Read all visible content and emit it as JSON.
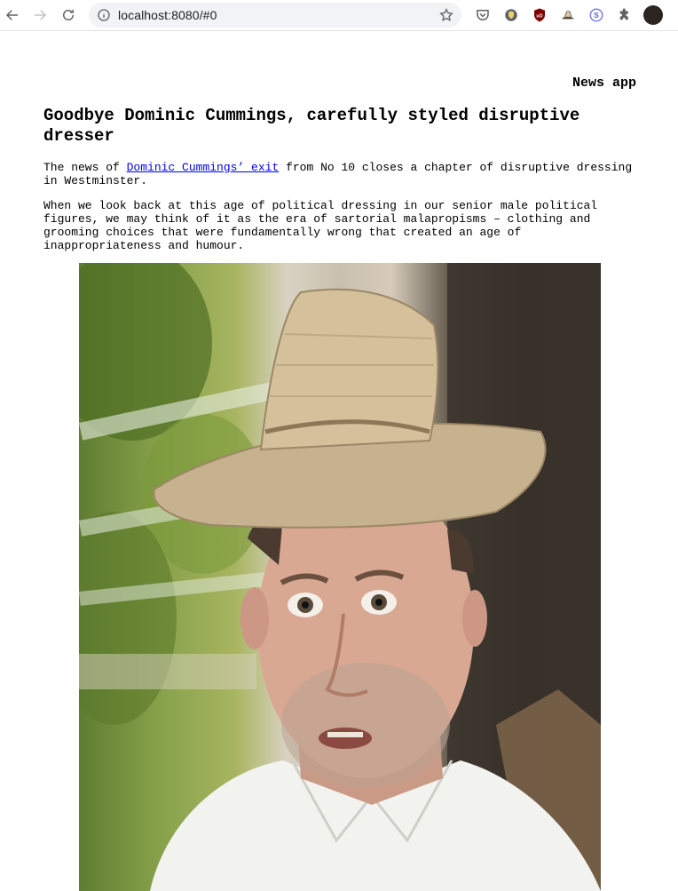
{
  "browser": {
    "url": "localhost:8080/#0"
  },
  "page": {
    "brand": "News app",
    "headline": "Goodbye Dominic Cummings, carefully styled disruptive dresser",
    "p1_before": "The news of ",
    "p1_link": "Dominic Cummings’ exit",
    "p1_after": " from No 10 closes a chapter of disruptive dressing in Westminster.",
    "p2": "When we look back at this age of political dressing in our senior male political figures, we may think of it as the era of sartorial malapropisms – clothing and grooming choices that were fundamentally wrong that created an age of inappropriateness and humour."
  },
  "icons": {
    "back": "arrow-left-icon",
    "forward": "arrow-right-icon",
    "reload": "reload-icon",
    "site_info": "info-icon",
    "bookmark": "star-icon",
    "extensions": [
      "pocket-icon",
      "shield-icon",
      "ublock-icon",
      "hat-extension-icon",
      "s-extension-icon",
      "puzzle-icon"
    ]
  },
  "colors": {
    "link": "#0000ee",
    "text": "#000000"
  }
}
